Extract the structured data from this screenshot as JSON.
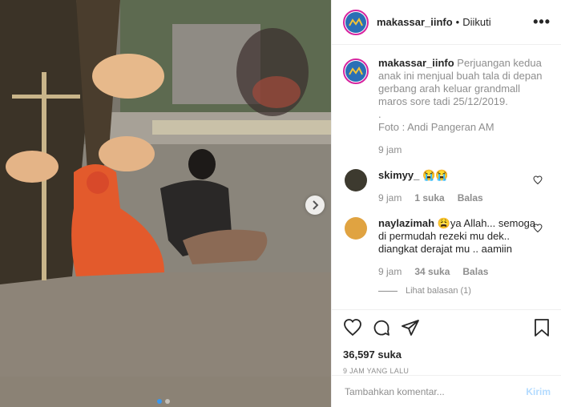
{
  "account": {
    "username": "makassar_iinfo",
    "separator": "•",
    "follow_status": "Diikuti"
  },
  "caption": {
    "username": "makassar_iinfo",
    "text": "Perjuangan kedua anak ini menjual buah tala di depan gerbang arah keluar grandmall maros sore tadi 25/12/2019.",
    "dot": ".",
    "credit": "Foto : Andi Pangeran AM",
    "time": "9 jam"
  },
  "comments": [
    {
      "username": "skimyy_",
      "text": "😭😭",
      "time": "9 jam",
      "likes": "1 suka",
      "reply": "Balas"
    },
    {
      "username": "naylazimah",
      "text": "😩ya Allah... semoga di permudah rezeki mu dek.. diangkat derajat mu .. aamiin",
      "time": "9 jam",
      "likes": "34 suka",
      "reply": "Balas",
      "view_replies": "Lihat balasan (1)"
    }
  ],
  "likes": "36,597 suka",
  "timestamp": "9 JAM YANG LALU",
  "add_comment": {
    "placeholder": "Tambahkan komentar...",
    "post_label": "Kirim"
  },
  "colors": {
    "accent": "#3897f0",
    "avatar_ring": "#d6249f",
    "post_button": "#b3dbff"
  },
  "icons": [
    "heart-icon",
    "comment-icon",
    "share-icon",
    "bookmark-icon",
    "more-icon",
    "chevron-right-icon"
  ]
}
